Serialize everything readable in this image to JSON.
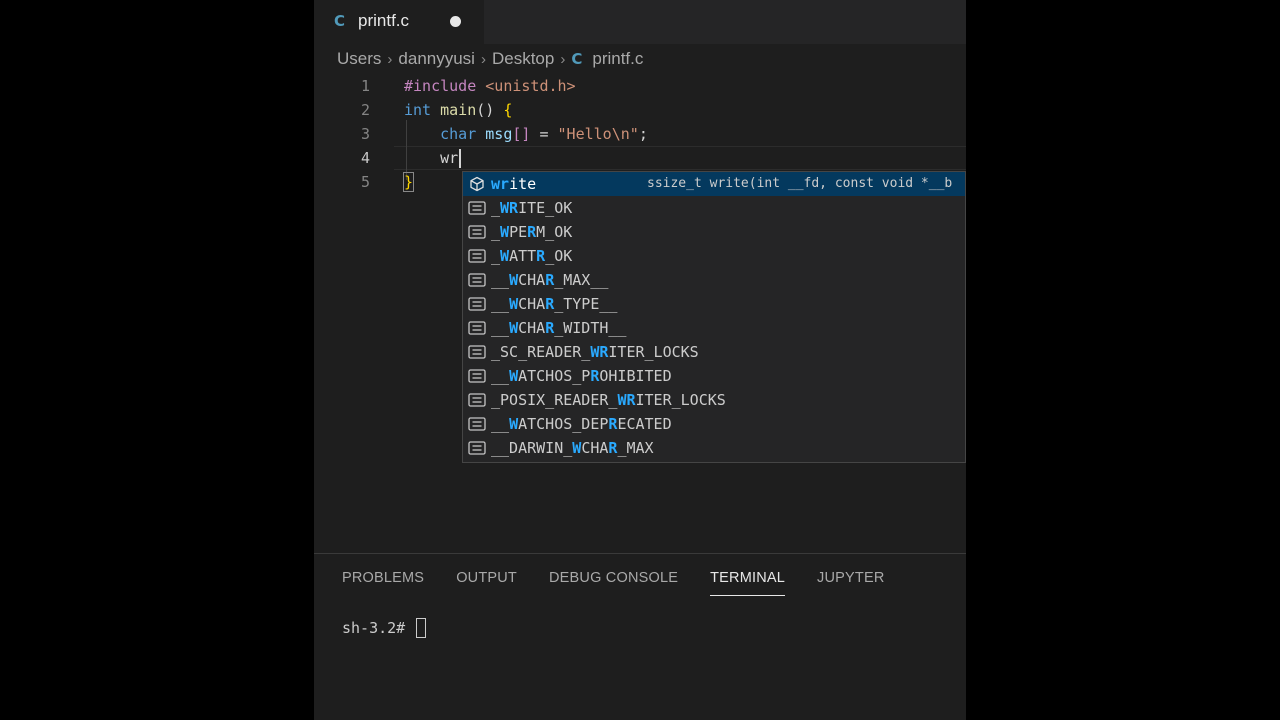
{
  "tab": {
    "filename": "printf.c",
    "file_icon": "C",
    "dirty": true
  },
  "breadcrumb": [
    "Users",
    "dannyyusi",
    "Desktop",
    "printf.c"
  ],
  "editor": {
    "line_numbers": [
      "1",
      "2",
      "3",
      "4",
      "5"
    ],
    "line1": {
      "preproc": "#include",
      "header": "<unistd.h>"
    },
    "line2": {
      "type": "int",
      "fn": "main",
      "parens": "()",
      "brace": "{"
    },
    "line3": {
      "type": "char",
      "var": "msg",
      "brackets": "[]",
      "eq": " = ",
      "str": "\"Hello\\n\"",
      "semi": ";"
    },
    "line4": {
      "typed": "wr"
    },
    "line5": {
      "brace": "}"
    }
  },
  "suggestions": [
    {
      "kind": "method",
      "parts": [
        [
          "wr",
          true
        ],
        [
          "ite",
          false
        ]
      ],
      "detail": "ssize_t write(int __fd, const void *__b"
    },
    {
      "kind": "constant",
      "parts": [
        [
          "_",
          false
        ],
        [
          "WR",
          true
        ],
        [
          "ITE_OK",
          false
        ]
      ]
    },
    {
      "kind": "constant",
      "parts": [
        [
          "_",
          false
        ],
        [
          "W",
          true
        ],
        [
          "PE",
          false
        ],
        [
          "R",
          true
        ],
        [
          "M_OK",
          false
        ]
      ]
    },
    {
      "kind": "constant",
      "parts": [
        [
          "_",
          false
        ],
        [
          "W",
          true
        ],
        [
          "ATT",
          false
        ],
        [
          "R",
          true
        ],
        [
          "_OK",
          false
        ]
      ]
    },
    {
      "kind": "constant",
      "parts": [
        [
          "__",
          false
        ],
        [
          "W",
          true
        ],
        [
          "CHA",
          false
        ],
        [
          "R",
          true
        ],
        [
          "_MAX__",
          false
        ]
      ]
    },
    {
      "kind": "constant",
      "parts": [
        [
          "__",
          false
        ],
        [
          "W",
          true
        ],
        [
          "CHA",
          false
        ],
        [
          "R",
          true
        ],
        [
          "_TYPE__",
          false
        ]
      ]
    },
    {
      "kind": "constant",
      "parts": [
        [
          "__",
          false
        ],
        [
          "W",
          true
        ],
        [
          "CHA",
          false
        ],
        [
          "R",
          true
        ],
        [
          "_WIDTH__",
          false
        ]
      ]
    },
    {
      "kind": "constant",
      "parts": [
        [
          "_SC_READER_",
          false
        ],
        [
          "WR",
          true
        ],
        [
          "ITER_LOCKS",
          false
        ]
      ]
    },
    {
      "kind": "constant",
      "parts": [
        [
          "__",
          false
        ],
        [
          "W",
          true
        ],
        [
          "ATCHOS_P",
          false
        ],
        [
          "R",
          true
        ],
        [
          "OHIBITED",
          false
        ]
      ]
    },
    {
      "kind": "constant",
      "parts": [
        [
          "_POSIX_READER_",
          false
        ],
        [
          "WR",
          true
        ],
        [
          "ITER_LOCKS",
          false
        ]
      ]
    },
    {
      "kind": "constant",
      "parts": [
        [
          "__",
          false
        ],
        [
          "W",
          true
        ],
        [
          "ATCHOS_DEP",
          false
        ],
        [
          "R",
          true
        ],
        [
          "ECATED",
          false
        ]
      ]
    },
    {
      "kind": "constant",
      "parts": [
        [
          "__DARWIN_",
          false
        ],
        [
          "W",
          true
        ],
        [
          "CHA",
          false
        ],
        [
          "R",
          true
        ],
        [
          "_MAX",
          false
        ]
      ]
    }
  ],
  "panel": {
    "tabs": [
      "PROBLEMS",
      "OUTPUT",
      "DEBUG CONSOLE",
      "TERMINAL",
      "JUPYTER"
    ],
    "active_tab": "TERMINAL",
    "terminal_prompt": "sh-3.2# "
  },
  "colors": {
    "match_highlight": "#2aaaff",
    "selection": "#04395e",
    "editor_bg": "#1e1e1e"
  }
}
